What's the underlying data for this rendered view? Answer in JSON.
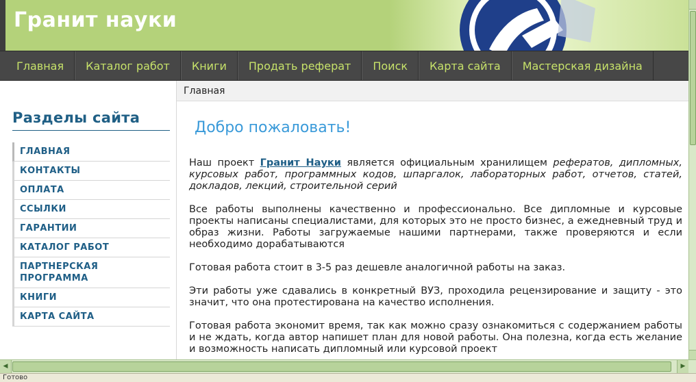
{
  "header": {
    "site_title": "Гранит науки"
  },
  "nav": {
    "items": [
      {
        "label": "Главная"
      },
      {
        "label": "Каталог работ"
      },
      {
        "label": "Книги"
      },
      {
        "label": "Продать реферат"
      },
      {
        "label": "Поиск"
      },
      {
        "label": "Карта сайта"
      },
      {
        "label": "Мастерская дизайна"
      }
    ]
  },
  "sidebar": {
    "title": "Разделы сайта",
    "items": [
      {
        "label": "ГЛАВНАЯ"
      },
      {
        "label": "КОНТАКТЫ"
      },
      {
        "label": "ОПЛАТА"
      },
      {
        "label": "ССЫЛКИ"
      },
      {
        "label": "ГАРАНТИИ"
      },
      {
        "label": "КАТАЛОГ РАБОТ"
      },
      {
        "label": "ПАРТНЕРСКАЯ ПРОГРАММА"
      },
      {
        "label": "КНИГИ"
      },
      {
        "label": "КАРТА САЙТА"
      }
    ]
  },
  "main": {
    "breadcrumb": "Главная",
    "welcome": "Добро пожаловать!",
    "intro": {
      "before": "Наш проект ",
      "link": "Гранит Науки",
      "middle": " является официальным хранилищем ",
      "list": "рефератов, дипломных, курсовых работ, программных кодов, шпаргалок, лабораторных работ, отчетов, статей, докладов, лекций, строительной серий"
    },
    "paragraphs": [
      "Все работы выполнены качественно и профессионально. Все дипломные и курсовые проекты написаны специалистами, для которых это не просто бизнес, а ежедневный труд и образ жизни. Работы загружаемые нашими партнерами, также проверяются и если необходимо дорабатываются",
      "Готовая работа стоит в 3-5 раз дешевле аналогичной работы на заказ.",
      "Эти работы уже сдавались в конкретный ВУЗ, проходила рецензирование и защиту - это значит, что она протестирована на качество исполнения.",
      "Готовая работа экономит время, так как можно сразу ознакомиться с содержанием работы и не ждать, когда автор напишет план для новой работы. Она полезна, когда есть желание и возможность написать дипломный или курсовой проект"
    ]
  },
  "statusbar": {
    "text": "Готово"
  },
  "colors": {
    "header_green": "#b4d27a",
    "nav_bg": "#474747",
    "nav_text": "#c7e26a",
    "sidebar_blue": "#1f5f85",
    "welcome_blue": "#3a9ad9"
  }
}
